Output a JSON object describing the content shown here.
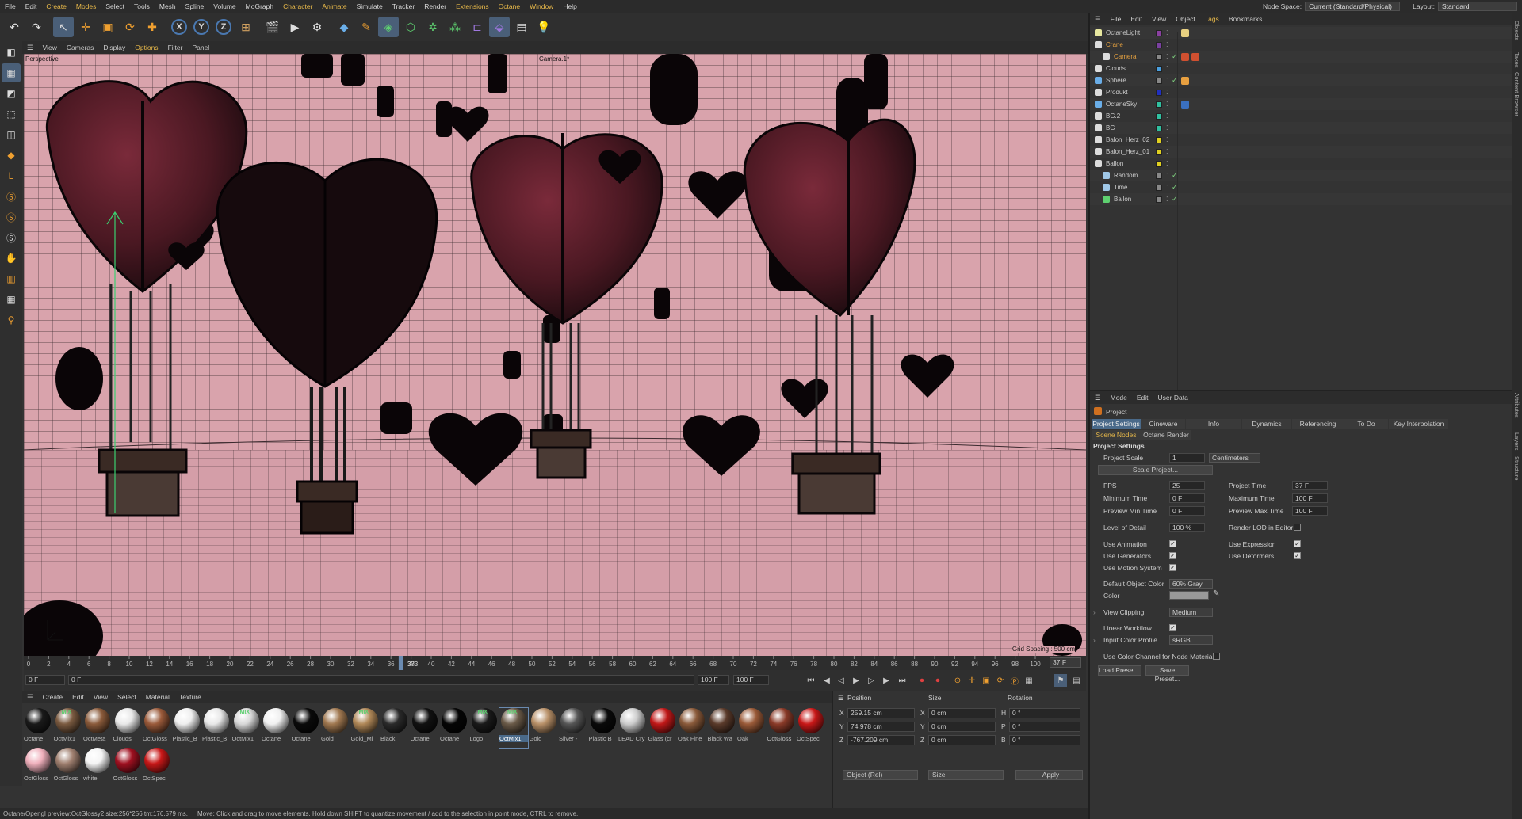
{
  "menubar": {
    "items": [
      "File",
      "Edit",
      "Create",
      "Modes",
      "Select",
      "Tools",
      "Mesh",
      "Spline",
      "Volume",
      "MoGraph",
      "Character",
      "Animate",
      "Simulate",
      "Tracker",
      "Render",
      "Extensions",
      "Octane",
      "Window",
      "Help"
    ],
    "node_space_label": "Node Space:",
    "node_space_value": "Current (Standard/Physical)",
    "layout_label": "Layout:",
    "layout_value": "Standard"
  },
  "toolbar": {
    "icons": [
      "undo-icon",
      "redo-icon",
      "select-icon",
      "move-icon",
      "scale-icon",
      "rotate-icon",
      "add-icon",
      "x-axis-icon",
      "y-axis-icon",
      "z-axis-icon",
      "world-icon",
      "render-view-icon",
      "render-icon",
      "render-settings-icon",
      "cube-icon",
      "pen-icon",
      "subdivide-icon",
      "extrude-icon",
      "cloner-icon",
      "effector-icon",
      "deformer-icon",
      "scene-icon",
      "camera-icon",
      "light-icon"
    ],
    "axis_labels": [
      "X",
      "Y",
      "Z"
    ]
  },
  "viewport": {
    "menu": [
      "View",
      "Cameras",
      "Display",
      "Options",
      "Filter",
      "Panel"
    ],
    "view_name": "Perspective",
    "camera_name": "Camera.1*",
    "grid_spacing": "Grid Spacing : 500 cm"
  },
  "timeline": {
    "ticks": [
      "0",
      "2",
      "4",
      "6",
      "8",
      "10",
      "12",
      "14",
      "16",
      "18",
      "20",
      "22",
      "24",
      "26",
      "28",
      "30",
      "32",
      "34",
      "36",
      "38",
      "40",
      "42",
      "44",
      "46",
      "48",
      "50",
      "52",
      "54",
      "56",
      "58",
      "60",
      "62",
      "64",
      "66",
      "68",
      "70",
      "72",
      "74",
      "76",
      "78",
      "80",
      "82",
      "84",
      "86",
      "88",
      "90",
      "92",
      "94",
      "96",
      "98",
      "100"
    ],
    "current_frame": "37 F",
    "playhead_label": "373",
    "playhead_frame": 37
  },
  "transport": {
    "start_field": "0 F",
    "preview_start": "0 F",
    "end_field": "100 F",
    "preview_end": "100 F"
  },
  "materials": {
    "menu": [
      "Create",
      "Edit",
      "View",
      "Select",
      "Material",
      "Texture"
    ],
    "items": [
      {
        "name": "Octane",
        "color": "#1a1a1a",
        "mix": false
      },
      {
        "name": "OctMix1",
        "color": "#7a5a40",
        "mix": true
      },
      {
        "name": "OctMeta",
        "color": "#8a5a3a",
        "mix": false
      },
      {
        "name": "Clouds",
        "color": "#e8e8e8",
        "mix": false
      },
      {
        "name": "OctGloss",
        "color": "#9a5a3a",
        "mix": false
      },
      {
        "name": "Plastic_B",
        "color": "#efefef",
        "mix": false
      },
      {
        "name": "Plastic_B",
        "color": "#e8e8e8",
        "mix": false
      },
      {
        "name": "OctMix1",
        "color": "#d8d8d8",
        "mix": true
      },
      {
        "name": "Octane",
        "color": "#f0f0f0",
        "mix": false
      },
      {
        "name": "Octane",
        "color": "#0a0a0a",
        "mix": false
      },
      {
        "name": "Gold",
        "color": "#a07850",
        "mix": false
      },
      {
        "name": "Gold_Mi",
        "color": "#b08858",
        "mix": true
      },
      {
        "name": "Black",
        "color": "#2a2a2a",
        "mix": false
      },
      {
        "name": "Octane",
        "color": "#111111",
        "mix": false
      },
      {
        "name": "Octane",
        "color": "#050505",
        "mix": false
      },
      {
        "name": "Logo",
        "color": "#1a1a1a",
        "mix": true
      },
      {
        "name": "OctMix1",
        "color": "#6a5a48",
        "mix": true
      },
      {
        "name": "Gold",
        "color": "#b89068",
        "mix": false
      },
      {
        "name": "Silver -",
        "color": "#555555",
        "mix": false
      },
      {
        "name": "Plastic B",
        "color": "#0a0a0a",
        "mix": false
      },
      {
        "name": "LEAD Cry",
        "color": "#cccccc",
        "mix": false
      },
      {
        "name": "Glass (cr",
        "color": "#c01818",
        "mix": false
      },
      {
        "name": "Oak Fine",
        "color": "#8a5a3a",
        "mix": false
      },
      {
        "name": "Black Wa",
        "color": "#5a3a2a",
        "mix": false
      },
      {
        "name": "Oak",
        "color": "#9a5a38",
        "mix": false
      },
      {
        "name": "OctGloss",
        "color": "#8a3a28",
        "mix": false
      },
      {
        "name": "OctSpec",
        "color": "#c81818",
        "mix": false
      },
      {
        "name": "OctGloss",
        "color": "#f0b0bc",
        "mix": false
      },
      {
        "name": "OctGloss",
        "color": "#a08070",
        "mix": false
      },
      {
        "name": "white",
        "color": "#f4f4f4",
        "mix": false
      },
      {
        "name": "OctGloss",
        "color": "#a01020",
        "mix": false
      },
      {
        "name": "OctSpec",
        "color": "#c81818",
        "mix": false
      }
    ],
    "selected_index": 16
  },
  "coords": {
    "headers": [
      "Position",
      "Size",
      "Rotation"
    ],
    "rows": [
      {
        "axis": "X",
        "pos": "259.15 cm",
        "size_axis": "X",
        "size": "0 cm",
        "rot_axis": "H",
        "rot": "0 °"
      },
      {
        "axis": "Y",
        "pos": "74.978 cm",
        "size_axis": "Y",
        "size": "0 cm",
        "rot_axis": "P",
        "rot": "0 °"
      },
      {
        "axis": "Z",
        "pos": "-767.209 cm",
        "size_axis": "Z",
        "size": "0 cm",
        "rot_axis": "B",
        "rot": "0 °"
      }
    ],
    "mode_dropdown": "Object (Rel)",
    "size_dropdown": "Size",
    "apply_label": "Apply"
  },
  "status": {
    "left": "Octane/Opengl preview:OctGlossy2  size:256*256  tm:176.579 ms.",
    "message": "Move: Click and drag to move elements. Hold down SHIFT to quantize movement / add to the selection in point mode, CTRL to remove."
  },
  "objects": {
    "menu": [
      "File",
      "Edit",
      "View",
      "Object",
      "Tags",
      "Bookmarks"
    ],
    "rows": [
      {
        "name": "OctaneLight",
        "indent": 0,
        "icon": "light-icon",
        "color": "#8a40a0",
        "selected": false,
        "check": false,
        "tags": [
          "light-tag"
        ]
      },
      {
        "name": "Crane",
        "indent": 0,
        "icon": "null-icon",
        "color": "#7a40a0",
        "selected": true,
        "check": false,
        "tags": []
      },
      {
        "name": "Camera",
        "indent": 1,
        "icon": "camera-icon",
        "color": "#888888",
        "selected": true,
        "check": true,
        "tags": [
          "camera-tag",
          "target-tag"
        ]
      },
      {
        "name": "Clouds",
        "indent": 0,
        "icon": "null-icon",
        "color": "#4aa0e0",
        "selected": false,
        "check": false,
        "tags": []
      },
      {
        "name": "Sphere",
        "indent": 0,
        "icon": "sphere-icon",
        "color": "#888888",
        "selected": false,
        "check": true,
        "tags": [
          "material-tag"
        ]
      },
      {
        "name": "Produkt",
        "indent": 0,
        "icon": "null-icon",
        "color": "#2030c0",
        "selected": false,
        "check": false,
        "tags": []
      },
      {
        "name": "OctaneSky",
        "indent": 0,
        "icon": "sky-icon",
        "color": "#30c0a0",
        "selected": false,
        "check": false,
        "tags": [
          "sky-tag"
        ]
      },
      {
        "name": "BG.2",
        "indent": 0,
        "icon": "null-icon",
        "color": "#30c0a0",
        "selected": false,
        "check": false,
        "tags": []
      },
      {
        "name": "BG",
        "indent": 0,
        "icon": "null-icon",
        "color": "#30c0a0",
        "selected": false,
        "check": false,
        "tags": []
      },
      {
        "name": "Balon_Herz_02",
        "indent": 0,
        "icon": "null-icon",
        "color": "#e0d020",
        "selected": false,
        "check": false,
        "tags": []
      },
      {
        "name": "Balon_Herz_01",
        "indent": 0,
        "icon": "null-icon",
        "color": "#e0d020",
        "selected": false,
        "check": false,
        "tags": []
      },
      {
        "name": "Ballon",
        "indent": 0,
        "icon": "null-icon",
        "color": "#e0d020",
        "selected": false,
        "check": false,
        "tags": []
      },
      {
        "name": "Random",
        "indent": 1,
        "icon": "effector-icon",
        "color": "#888888",
        "selected": false,
        "check": true,
        "tags": []
      },
      {
        "name": "Time",
        "indent": 1,
        "icon": "effector-icon",
        "color": "#888888",
        "selected": false,
        "check": true,
        "tags": []
      },
      {
        "name": "Ballon",
        "indent": 1,
        "icon": "cloner-icon",
        "color": "#888888",
        "selected": false,
        "check": true,
        "tags": []
      }
    ]
  },
  "attributes": {
    "menu": [
      "Mode",
      "Edit",
      "User Data"
    ],
    "title": "Project",
    "tabs": [
      "Project Settings",
      "Cineware",
      "Info",
      "Dynamics",
      "Referencing",
      "To Do",
      "Key Interpolation"
    ],
    "subtabs": [
      "Scene Nodes",
      "Octane Render"
    ],
    "section": "Project Settings",
    "project_scale_label": "Project Scale",
    "project_scale_value": "1",
    "project_scale_unit": "Centimeters",
    "scale_project_btn": "Scale Project...",
    "fps_label": "FPS",
    "fps": "25",
    "project_time_label": "Project Time",
    "project_time": "37 F",
    "min_time_label": "Minimum Time",
    "min_time": "0 F",
    "max_time_label": "Maximum Time",
    "max_time": "100 F",
    "preview_min_label": "Preview Min Time",
    "preview_min": "0 F",
    "preview_max_label": "Preview Max Time",
    "preview_max": "100 F",
    "lod_label": "Level of Detail",
    "lod": "100 %",
    "render_lod_label": "Render LOD in Editor",
    "use_animation": "Use Animation",
    "use_expression": "Use Expression",
    "use_generators": "Use Generators",
    "use_deformers": "Use Deformers",
    "use_motion": "Use Motion System",
    "default_color_label": "Default Object Color",
    "default_color_value": "60% Gray",
    "color_label": "Color",
    "view_clipping_label": "View Clipping",
    "view_clipping_value": "Medium",
    "linear_workflow_label": "Linear Workflow",
    "input_color_label": "Input Color Profile",
    "input_color_value": "sRGB",
    "use_color_channel_label": "Use Color Channel for Node Material",
    "load_preset": "Load Preset...",
    "save_preset": "Save Preset..."
  },
  "side_tabs": [
    "Objects",
    "Takes",
    "Content Browser",
    "Attributes",
    "Layers",
    "Structure"
  ]
}
